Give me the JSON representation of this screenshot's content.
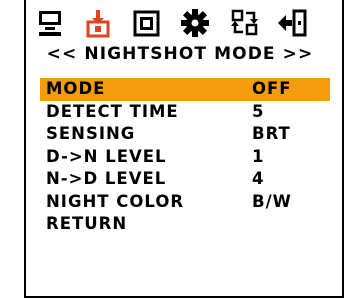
{
  "icons": [
    "monitor-icon",
    "camera-export-icon",
    "picture-in-picture-icon",
    "gear-icon",
    "swap-icon",
    "exit-icon"
  ],
  "menu": {
    "title": "<< NIGHTSHOT MODE >>",
    "accent_color": "#f39c0e",
    "items": [
      {
        "label": "MODE",
        "value": "OFF",
        "selected": true
      },
      {
        "label": "DETECT TIME",
        "value": "5"
      },
      {
        "label": "SENSING",
        "value": "BRT"
      },
      {
        "label": "D->N LEVEL",
        "value": "1"
      },
      {
        "label": "N->D LEVEL",
        "value": "4"
      },
      {
        "label": "NIGHT COLOR",
        "value": "B/W"
      },
      {
        "label": "RETURN",
        "value": ""
      }
    ]
  }
}
